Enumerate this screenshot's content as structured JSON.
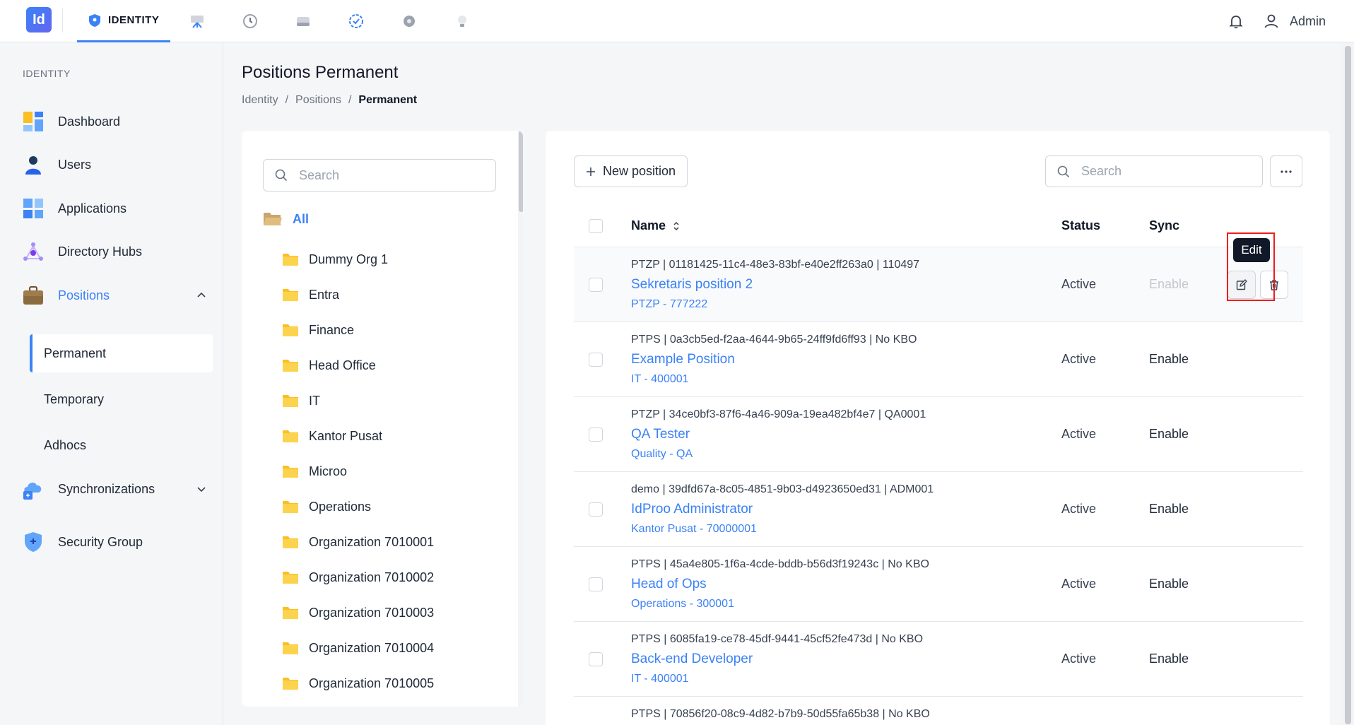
{
  "topbar": {
    "logo": "Id",
    "active_tab": "IDENTITY",
    "nav_icons": [
      "monitor-icon",
      "history-icon",
      "drive-icon",
      "badge-check-icon",
      "gear-icon",
      "bulb-icon"
    ],
    "user": "Admin"
  },
  "sidebar": {
    "section": "IDENTITY",
    "items": [
      {
        "label": "Dashboard",
        "icon": "dashboard-icon"
      },
      {
        "label": "Users",
        "icon": "user-icon"
      },
      {
        "label": "Applications",
        "icon": "apps-icon"
      },
      {
        "label": "Directory Hubs",
        "icon": "hub-icon"
      },
      {
        "label": "Positions",
        "icon": "briefcase-icon"
      },
      {
        "label": "Synchronizations",
        "icon": "cloud-sync-icon"
      },
      {
        "label": "Security Group",
        "icon": "shield-icon"
      }
    ],
    "positions_sub": [
      "Permanent",
      "Temporary",
      "Adhocs"
    ]
  },
  "page": {
    "title": "Positions Permanent",
    "breadcrumb": [
      "Identity",
      "Positions",
      "Permanent"
    ]
  },
  "tree": {
    "search_placeholder": "Search",
    "root": "All",
    "nodes": [
      "Dummy Org 1",
      "Entra",
      "Finance",
      "Head Office",
      "IT",
      "Kantor Pusat",
      "Microo",
      "Operations",
      "Organization 7010001",
      "Organization 7010002",
      "Organization 7010003",
      "Organization 7010004",
      "Organization 7010005"
    ]
  },
  "table": {
    "new_button": "New position",
    "search_placeholder": "Search",
    "columns": {
      "name": "Name",
      "status": "Status",
      "sync": "Sync"
    },
    "tooltip": "Edit",
    "rows": [
      {
        "meta": "PTZP | 01181425-11c4-48e3-83bf-e40e2ff263a0 | 110497",
        "name": "Sekretaris position 2",
        "sub": "PTZP - 777222",
        "status": "Active",
        "sync": "Enable"
      },
      {
        "meta": "PTPS | 0a3cb5ed-f2aa-4644-9b65-24ff9fd6ff93 | No KBO",
        "name": "Example Position",
        "sub": "IT - 400001",
        "status": "Active",
        "sync": "Enable"
      },
      {
        "meta": "PTZP | 34ce0bf3-87f6-4a46-909a-19ea482bf4e7 | QA0001",
        "name": "QA Tester",
        "sub": "Quality - QA",
        "status": "Active",
        "sync": "Enable"
      },
      {
        "meta": "demo | 39dfd67a-8c05-4851-9b03-d4923650ed31 | ADM001",
        "name": "IdProo Administrator",
        "sub": "Kantor Pusat - 70000001",
        "status": "Active",
        "sync": "Enable"
      },
      {
        "meta": "PTPS | 45a4e805-1f6a-4cde-bddb-b56d3f19243c | No KBO",
        "name": "Head of Ops",
        "sub": "Operations - 300001",
        "status": "Active",
        "sync": "Enable"
      },
      {
        "meta": "PTPS | 6085fa19-ce78-45df-9441-45cf52fe473d | No KBO",
        "name": "Back-end Developer",
        "sub": "IT - 400001",
        "status": "Active",
        "sync": "Enable"
      },
      {
        "meta": "PTPS | 70856f20-08c9-4d82-b7b9-50d55fa65b38 | No KBO",
        "name": "",
        "sub": "",
        "status": "",
        "sync": ""
      }
    ]
  },
  "colors": {
    "accent": "#3b82f6",
    "folder": "#fbbf24",
    "highlight": "#ef1c1c"
  }
}
